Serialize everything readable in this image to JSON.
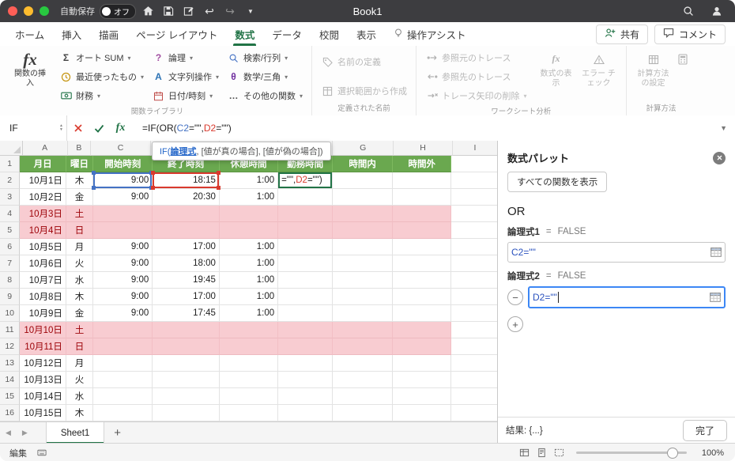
{
  "colors": {
    "excel_green": "#217346",
    "header_row_fill": "#6aa84f",
    "weekend_fill": "#f8ccd1",
    "weekend_text": "#9c0006",
    "ref_blue": "#4472c4",
    "ref_red": "#d93a2e",
    "edit_border": "#217346"
  },
  "titlebar": {
    "autosave_label": "自動保存",
    "autosave_state": "オフ",
    "title": "Book1"
  },
  "ribbon_tabs": [
    {
      "key": "home",
      "label": "ホーム",
      "active": false
    },
    {
      "key": "insert",
      "label": "挿入",
      "active": false
    },
    {
      "key": "draw",
      "label": "描画",
      "active": false
    },
    {
      "key": "page-layout",
      "label": "ページ レイアウト",
      "active": false
    },
    {
      "key": "formulas",
      "label": "数式",
      "active": true
    },
    {
      "key": "data",
      "label": "データ",
      "active": false
    },
    {
      "key": "review",
      "label": "校閲",
      "active": false
    },
    {
      "key": "view",
      "label": "表示",
      "active": false
    },
    {
      "key": "tell-me",
      "label": "操作アシスト",
      "active": false,
      "icon": "lightbulb-icon"
    }
  ],
  "header_actions": {
    "share": "共有",
    "comments": "コメント"
  },
  "ribbon": {
    "function_library": {
      "label": "関数ライブラリ",
      "insert_function": "関数の挿入",
      "items": [
        {
          "key": "autosum",
          "label": "オート SUM",
          "icon": "autosum-icon"
        },
        {
          "key": "recently-used",
          "label": "最近使ったもの",
          "icon": "recent-icon"
        },
        {
          "key": "financial",
          "label": "財務",
          "icon": "financial-icon"
        },
        {
          "key": "logical",
          "label": "論理",
          "icon": "logical-icon"
        },
        {
          "key": "text",
          "label": "文字列操作",
          "icon": "text-functions-icon"
        },
        {
          "key": "date-time",
          "label": "日付/時刻",
          "icon": "datetime-icon"
        },
        {
          "key": "lookup-reference",
          "label": "検索/行列",
          "icon": "lookup-icon"
        },
        {
          "key": "math-trig",
          "label": "数学/三角",
          "icon": "math-trig-icon"
        },
        {
          "key": "more-functions",
          "label": "その他の関数",
          "icon": "more-functions-icon"
        }
      ]
    },
    "defined_names": {
      "label": "定義された名前",
      "items": [
        {
          "key": "define-name",
          "label": "名前の定義",
          "icon": "define-name-icon",
          "disabled": true
        },
        {
          "key": "create-from-selection",
          "label": "選択範囲から作成",
          "icon": "create-from-selection-icon",
          "disabled": true
        }
      ]
    },
    "auditing": {
      "label": "ワークシート分析",
      "items": [
        {
          "key": "trace-precedents",
          "label": "参照元のトレース",
          "icon": "trace-precedents-icon",
          "disabled": true
        },
        {
          "key": "trace-dependents",
          "label": "参照先のトレース",
          "icon": "trace-dependents-icon",
          "disabled": true
        },
        {
          "key": "remove-arrows",
          "label": "トレース矢印の削除",
          "icon": "remove-arrows-icon",
          "disabled": true,
          "chevron": true
        }
      ],
      "big_items": [
        {
          "key": "show-formulas",
          "label": "数式の表示",
          "icon": "show-formulas-icon",
          "disabled": true
        },
        {
          "key": "error-checking",
          "label": "エラー チェック",
          "icon": "error-check-icon",
          "disabled": true
        }
      ]
    },
    "calculation": {
      "label": "計算方法",
      "big_items": [
        {
          "key": "calculation-options",
          "label": "計算方法の設定",
          "icon": "calc-options-icon",
          "disabled": true
        },
        {
          "key": "calculate-now",
          "label": "",
          "icon": "calculate-now-icon",
          "disabled": true
        }
      ]
    }
  },
  "formula_bar": {
    "name_box": "IF",
    "tokens": {
      "prefix": "=IF(OR(",
      "ref1": "C2",
      "mid": "=\"\",",
      "ref2": "D2",
      "suffix": "=\"\")"
    }
  },
  "function_hint": {
    "fn": "IF(",
    "current_arg": "論理式",
    "rest": ", [値が真の場合], [値が偽の場合])"
  },
  "grid": {
    "columns": [
      "A",
      "B",
      "C",
      "D",
      "E",
      "F",
      "G",
      "H",
      "I"
    ],
    "header_row": [
      "月日",
      "曜日",
      "開始時刻",
      "終了時刻",
      "休憩時間",
      "勤務時間",
      "時間内",
      "時間外",
      ""
    ],
    "edit_cell_tokens": {
      "before": "=\"\",",
      "ref": "D2",
      "after": "=\"\")"
    },
    "rows": [
      {
        "n": 2,
        "date": "10月1日",
        "day": "木",
        "start": "9:00",
        "end": "18:15",
        "break": "1:00",
        "weekend": false,
        "editing": true
      },
      {
        "n": 3,
        "date": "10月2日",
        "day": "金",
        "start": "9:00",
        "end": "20:30",
        "break": "1:00",
        "weekend": false
      },
      {
        "n": 4,
        "date": "10月3日",
        "day": "土",
        "weekend": true
      },
      {
        "n": 5,
        "date": "10月4日",
        "day": "日",
        "weekend": true
      },
      {
        "n": 6,
        "date": "10月5日",
        "day": "月",
        "start": "9:00",
        "end": "17:00",
        "break": "1:00",
        "weekend": false
      },
      {
        "n": 7,
        "date": "10月6日",
        "day": "火",
        "start": "9:00",
        "end": "18:00",
        "break": "1:00",
        "weekend": false
      },
      {
        "n": 8,
        "date": "10月7日",
        "day": "水",
        "start": "9:00",
        "end": "19:45",
        "break": "1:00",
        "weekend": false
      },
      {
        "n": 9,
        "date": "10月8日",
        "day": "木",
        "start": "9:00",
        "end": "17:00",
        "break": "1:00",
        "weekend": false
      },
      {
        "n": 10,
        "date": "10月9日",
        "day": "金",
        "start": "9:00",
        "end": "17:45",
        "break": "1:00",
        "weekend": false
      },
      {
        "n": 11,
        "date": "10月10日",
        "day": "土",
        "weekend": true
      },
      {
        "n": 12,
        "date": "10月11日",
        "day": "日",
        "weekend": true
      },
      {
        "n": 13,
        "date": "10月12日",
        "day": "月",
        "weekend": false
      },
      {
        "n": 14,
        "date": "10月13日",
        "day": "火",
        "weekend": false
      },
      {
        "n": 15,
        "date": "10月14日",
        "day": "水",
        "weekend": false
      },
      {
        "n": 16,
        "date": "10月15日",
        "day": "木",
        "weekend": false
      }
    ]
  },
  "formula_builder": {
    "title": "数式パレット",
    "show_all_button": "すべての関数を表示",
    "function_name": "OR",
    "arguments": [
      {
        "label": "論理式1",
        "result": "FALSE",
        "value": "C2=\"\"",
        "focused": false,
        "removable": false
      },
      {
        "label": "論理式2",
        "result": "FALSE",
        "value": "D2=\"\"",
        "focused": true,
        "removable": true
      }
    ],
    "result_label": "結果:",
    "result_value": "{...}",
    "done_button": "完了"
  },
  "sheet_bar": {
    "tabs": [
      "Sheet1"
    ],
    "active_tab": "Sheet1"
  },
  "status_bar": {
    "mode": "編集",
    "zoom": "100%"
  }
}
